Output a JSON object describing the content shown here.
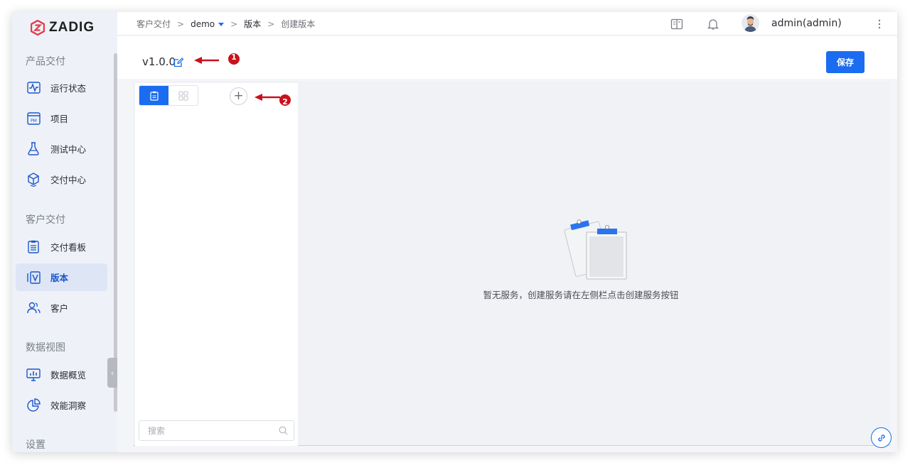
{
  "app": {
    "logo_text": "ZADIG"
  },
  "sidebar": {
    "sections": [
      {
        "title": "产品交付",
        "items": [
          {
            "label": "运行状态",
            "icon": "pulse-icon"
          },
          {
            "label": "项目",
            "icon": "project-pm-icon"
          },
          {
            "label": "测试中心",
            "icon": "flask-icon"
          },
          {
            "label": "交付中心",
            "icon": "package-icon"
          }
        ]
      },
      {
        "title": "客户交付",
        "items": [
          {
            "label": "交付看板",
            "icon": "clipboard-icon"
          },
          {
            "label": "版本",
            "icon": "version-icon",
            "active": true
          },
          {
            "label": "客户",
            "icon": "users-icon"
          }
        ]
      },
      {
        "title": "数据视图",
        "items": [
          {
            "label": "数据概览",
            "icon": "monitor-chart-icon"
          },
          {
            "label": "效能洞察",
            "icon": "pie-chart-icon"
          }
        ]
      },
      {
        "title": "设置",
        "items": []
      }
    ]
  },
  "breadcrumb": {
    "items": [
      "客户交付",
      "demo",
      "版本",
      "创建版本"
    ],
    "separator": ">"
  },
  "user": {
    "name": "admin(admin)"
  },
  "version_header": {
    "name": "v1.0.0",
    "save_label": "保存"
  },
  "annotations": {
    "marker_1": "1",
    "marker_2": "2"
  },
  "left_panel": {
    "add_symbol": "+",
    "search_placeholder": "搜索"
  },
  "empty_state": {
    "message": "暂无服务，创建服务请在左侧栏点击创建服务按钮"
  },
  "colors": {
    "accent": "#1a6cf0",
    "annotation_red": "#c8121c",
    "logo_red": "#e23c4c"
  }
}
